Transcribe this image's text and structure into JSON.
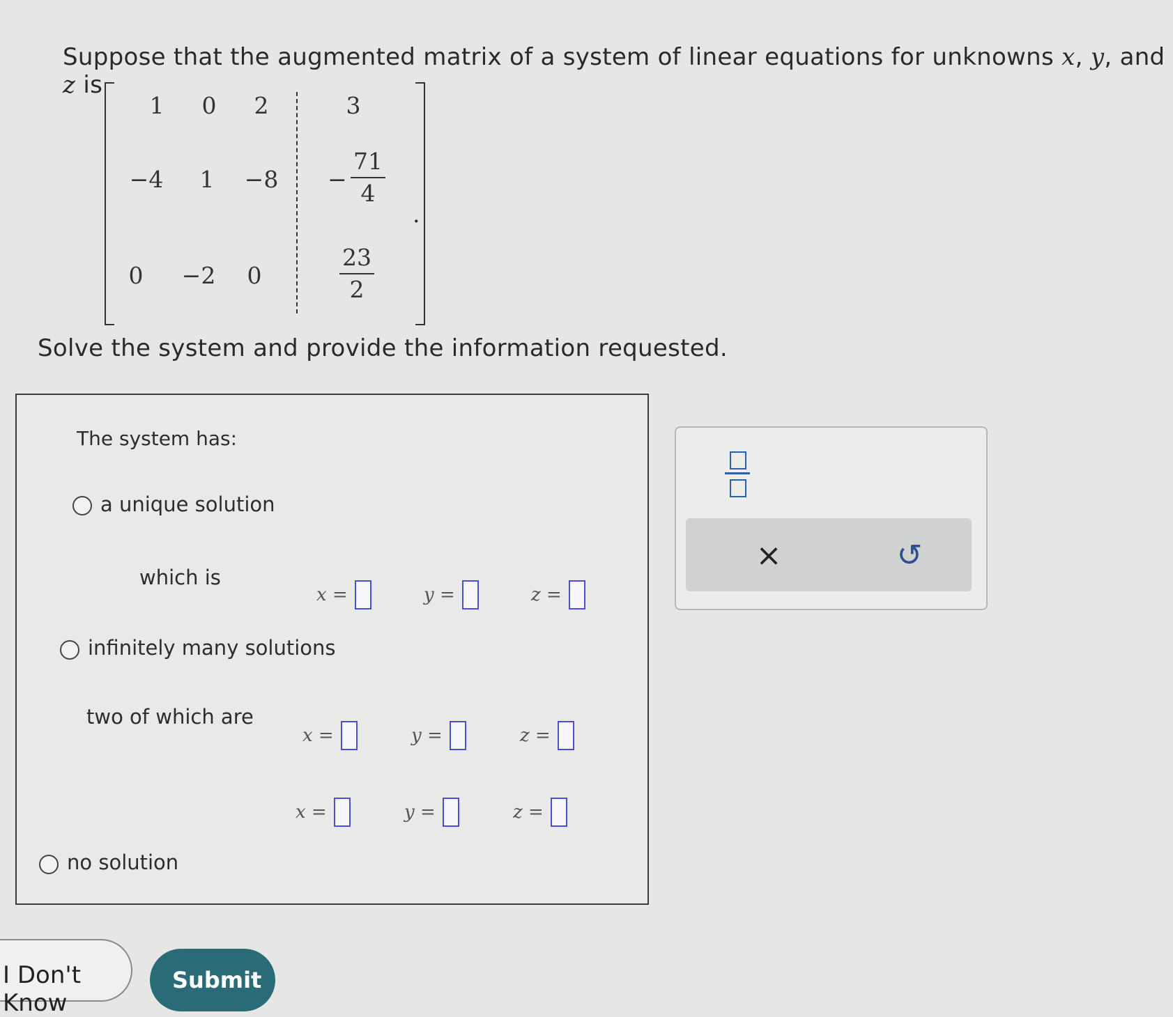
{
  "question": {
    "intro": "Suppose that the augmented matrix of a system of linear equations for unknowns",
    "var_x": "x",
    "comma1": ",",
    "var_y": "y",
    "and_text": ", and",
    "var_z": "z",
    "is_text": "is",
    "instruction": "Solve the system and provide the information requested."
  },
  "matrix": {
    "r1": [
      "1",
      "0",
      "2",
      "3"
    ],
    "r2": [
      "−4",
      "1",
      "−8"
    ],
    "r2_aug": {
      "sign": "−",
      "num": "71",
      "den": "4"
    },
    "r3": [
      "0",
      "−2",
      "0"
    ],
    "r3_aug": {
      "num": "23",
      "den": "2"
    },
    "period": "."
  },
  "panel": {
    "heading": "The system has:",
    "opt_unique": "a unique solution",
    "unique_sub": "which is",
    "opt_infinite": "infinitely many solutions",
    "infinite_sub": "two of which are",
    "opt_none": "no solution",
    "label_x": "x =",
    "label_y": "y =",
    "label_z": "z ="
  },
  "toolbar": {
    "clear_symbol": "×",
    "undo_symbol": "↺"
  },
  "buttons": {
    "dont_know": "I Don't Know",
    "submit": "Submit"
  }
}
